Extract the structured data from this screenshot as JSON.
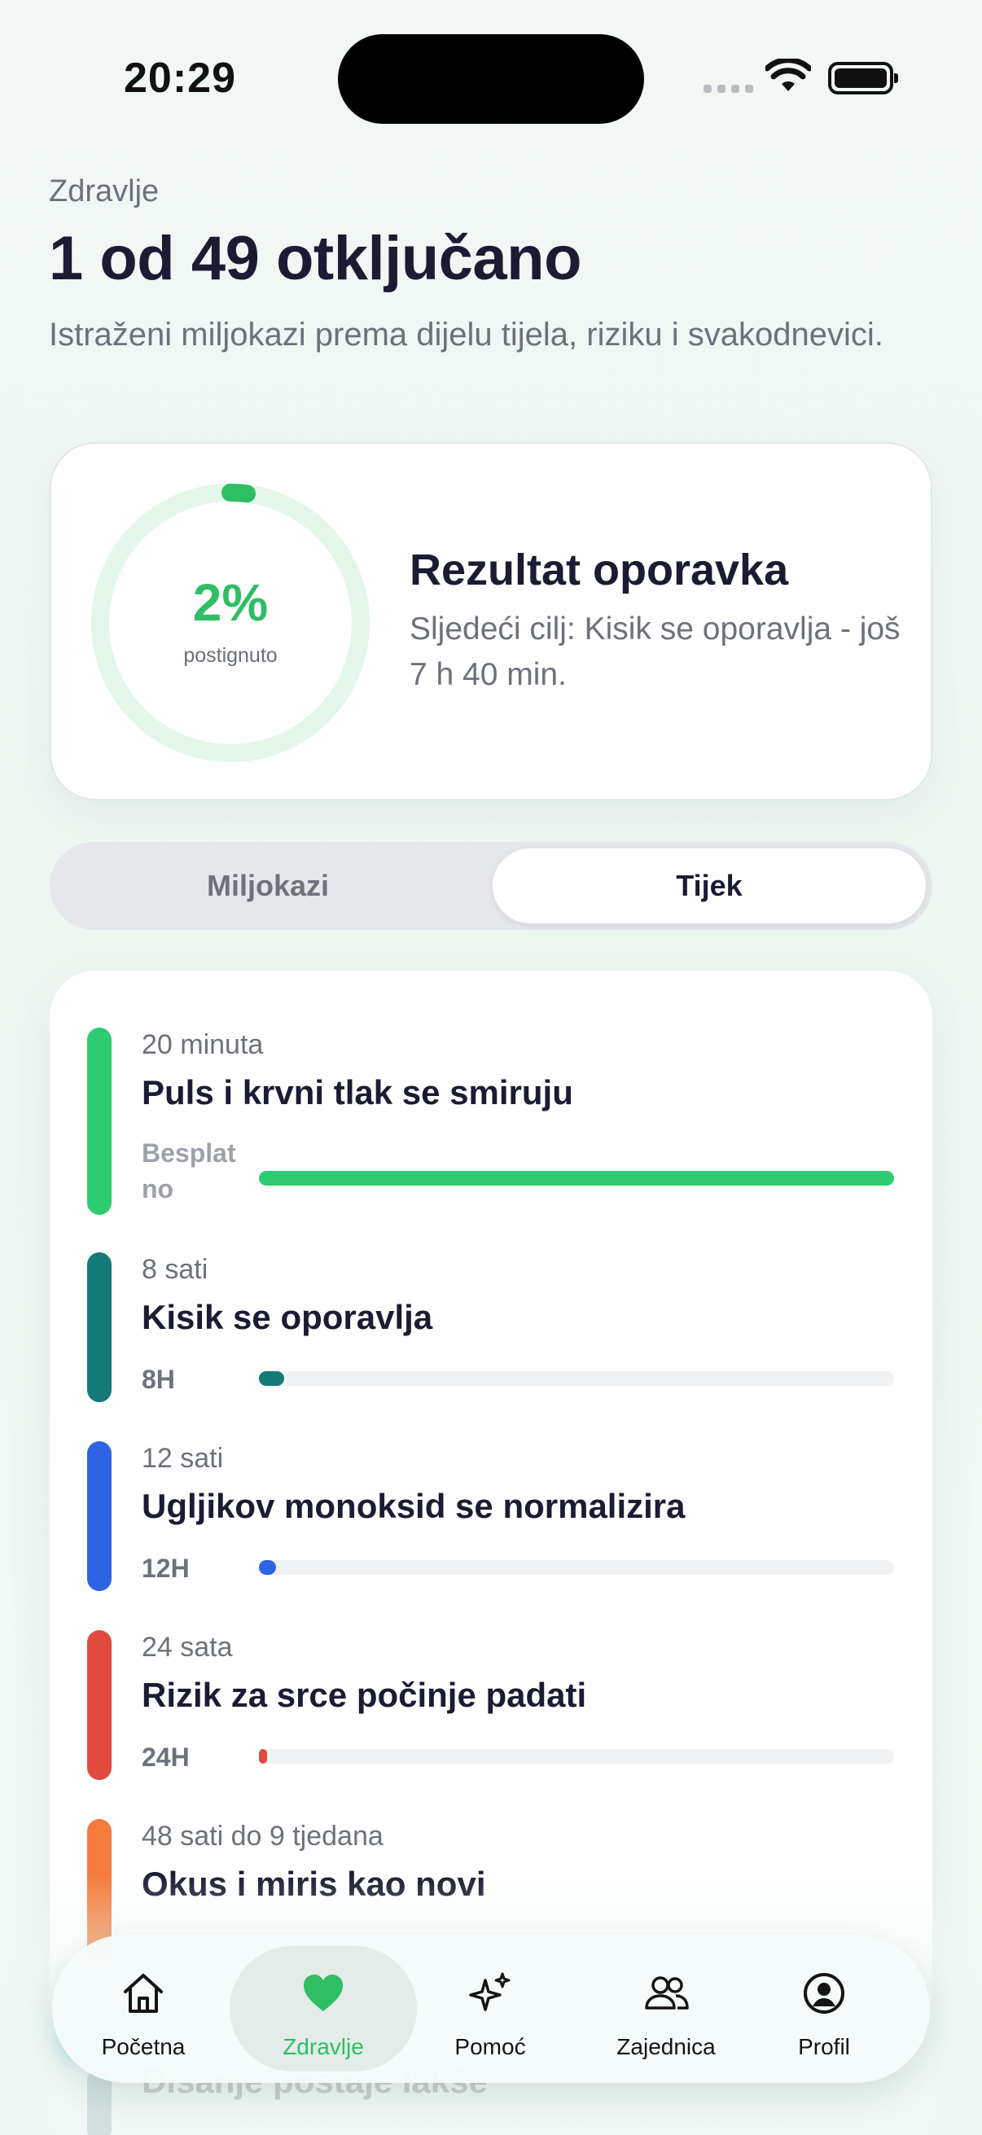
{
  "status_bar": {
    "time": "20:29"
  },
  "header": {
    "eyebrow": "Zdravlje",
    "title": "1 od 49 otključano",
    "subtitle": "Istraženi miljokazi prema dijelu tijela, riziku i svakodnevici."
  },
  "score": {
    "percent_label": "2%",
    "percent_value": 2,
    "caption": "postignuto",
    "title": "Rezultat oporavka",
    "next_goal": "Sljedeći cilj: Kisik se oporavlja - još 7 h 40 min.",
    "accent": "#2fbe64",
    "track": "#e3f6ea"
  },
  "segmented": {
    "options": [
      "Miljokazi",
      "Tijek"
    ],
    "selected": "Tijek"
  },
  "timeline": [
    {
      "time": "20 minuta",
      "title": "Puls i krvni tlak se smiruju",
      "tag": "Besplatno",
      "tag_line1": "Besplat",
      "tag_line2": "no",
      "progress": 1.0,
      "color": "#2ecc71"
    },
    {
      "time": "8 sati",
      "title": "Kisik se oporavlja",
      "tag": "8H",
      "progress": 0.04,
      "color": "#137a78"
    },
    {
      "time": "12 sati",
      "title": "Ugljikov monoksid se normalizira",
      "tag": "12H",
      "progress": 0.027,
      "color": "#2d64e3"
    },
    {
      "time": "24 sata",
      "title": "Rizik za srce počinje padati",
      "tag": "24H",
      "progress": 0.013,
      "color": "#e14b3f"
    },
    {
      "time": "48 sati do 9 tjedana",
      "title": "Okus i miris kao novi",
      "color": "#f47b3b"
    }
  ],
  "peek_item": {
    "title": "Disanje postaje lakše"
  },
  "tabbar": {
    "items": [
      {
        "label": "Početna",
        "icon": "home-icon"
      },
      {
        "label": "Zdravlje",
        "icon": "heart-icon",
        "active": true
      },
      {
        "label": "Pomoć",
        "icon": "sparkles-icon"
      },
      {
        "label": "Zajednica",
        "icon": "people-icon"
      },
      {
        "label": "Profil",
        "icon": "profile-icon"
      }
    ]
  }
}
